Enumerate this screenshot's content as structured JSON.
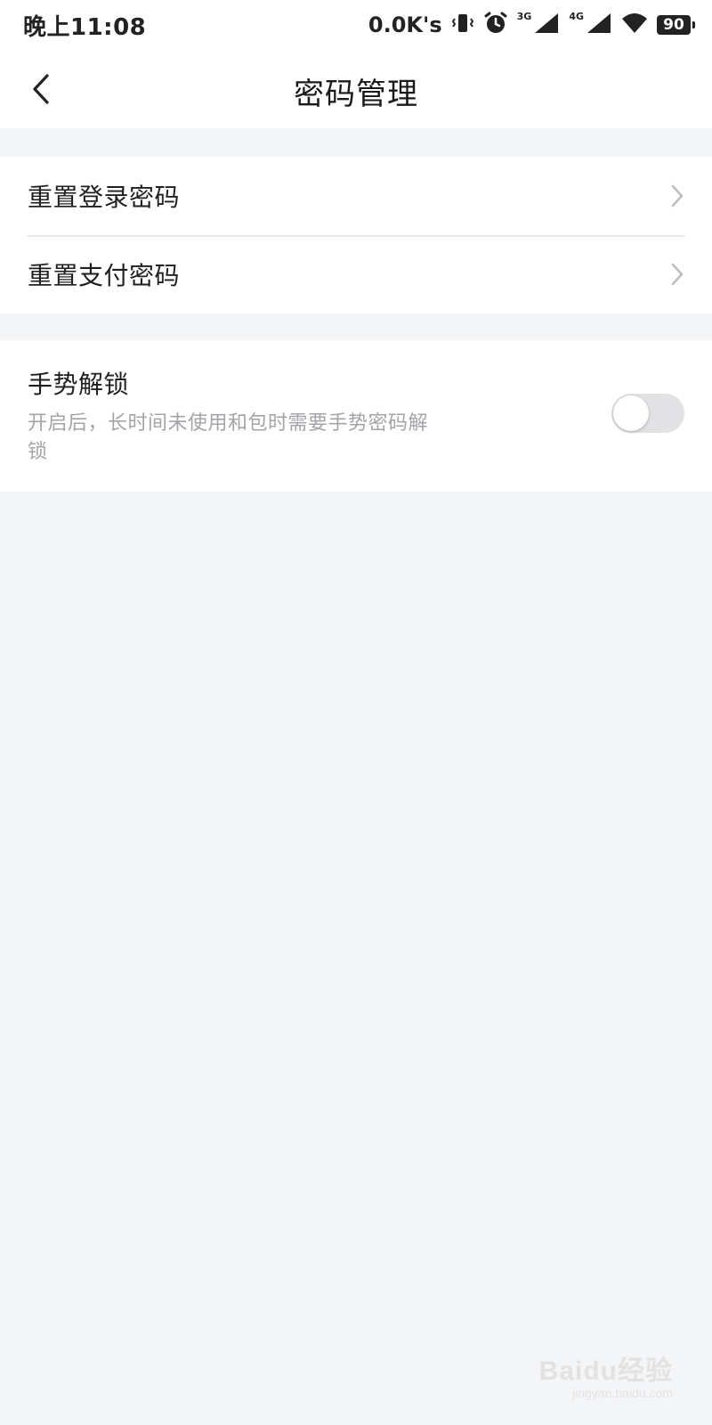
{
  "status_bar": {
    "time": "晚上11:08",
    "net_speed": "0.0K's",
    "signal_1_label": "3G",
    "signal_2_label": "4G",
    "battery": "90"
  },
  "nav": {
    "title": "密码管理"
  },
  "settings": {
    "items": [
      {
        "label": "重置登录密码"
      },
      {
        "label": "重置支付密码"
      }
    ],
    "gesture_unlock": {
      "title": "手势解锁",
      "description": "开启后，长时间未使用和包时需要手势密码解锁",
      "enabled": false
    }
  },
  "watermark": {
    "main": "Baidu经验",
    "sub": "jingyan.baidu.com"
  }
}
